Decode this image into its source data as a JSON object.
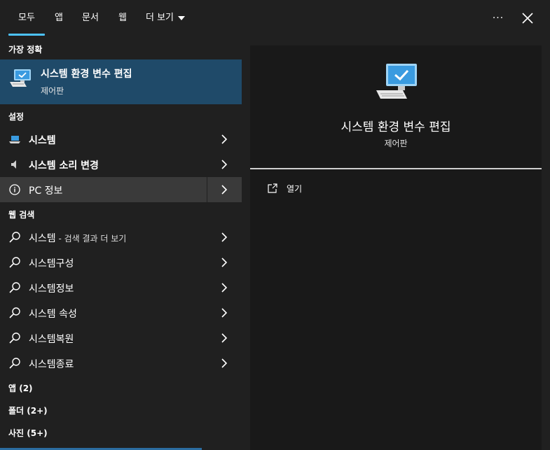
{
  "tabs": [
    {
      "label": "모두",
      "active": true
    },
    {
      "label": "앱"
    },
    {
      "label": "문서"
    },
    {
      "label": "웹"
    },
    {
      "label": "더 보기"
    }
  ],
  "sections": {
    "best_match": "가장 정확",
    "settings": "설정",
    "web_search": "웹 검색",
    "apps": "앱 (2)",
    "folders": "폴더 (2+)",
    "photos": "사진 (5+)"
  },
  "best_match": {
    "title": "시스템 환경 변수 편집",
    "subtitle": "제어판",
    "icon": "computer-settings-icon"
  },
  "settings_items": [
    {
      "label": "시스템",
      "icon": "laptop-icon"
    },
    {
      "label": "시스템 소리 변경",
      "icon": "speaker-icon"
    },
    {
      "label": "PC 정보",
      "icon": "info-icon",
      "selected": true
    }
  ],
  "web_items": [
    {
      "label": "시스템",
      "suffix": " - 검색 결과 더 보기"
    },
    {
      "label": "시스템구성"
    },
    {
      "label": "시스템정보"
    },
    {
      "label": "시스템 속성"
    },
    {
      "label": "시스템복원"
    },
    {
      "label": "시스템종료"
    }
  ],
  "preview": {
    "title": "시스템 환경 변수 편집",
    "subtitle": "제어판",
    "action_label": "열기"
  },
  "colors": {
    "accent": "#4cc2ff",
    "selected_bg": "#1f4a69",
    "panel_bg": "#202020",
    "preview_bg": "#191919"
  }
}
